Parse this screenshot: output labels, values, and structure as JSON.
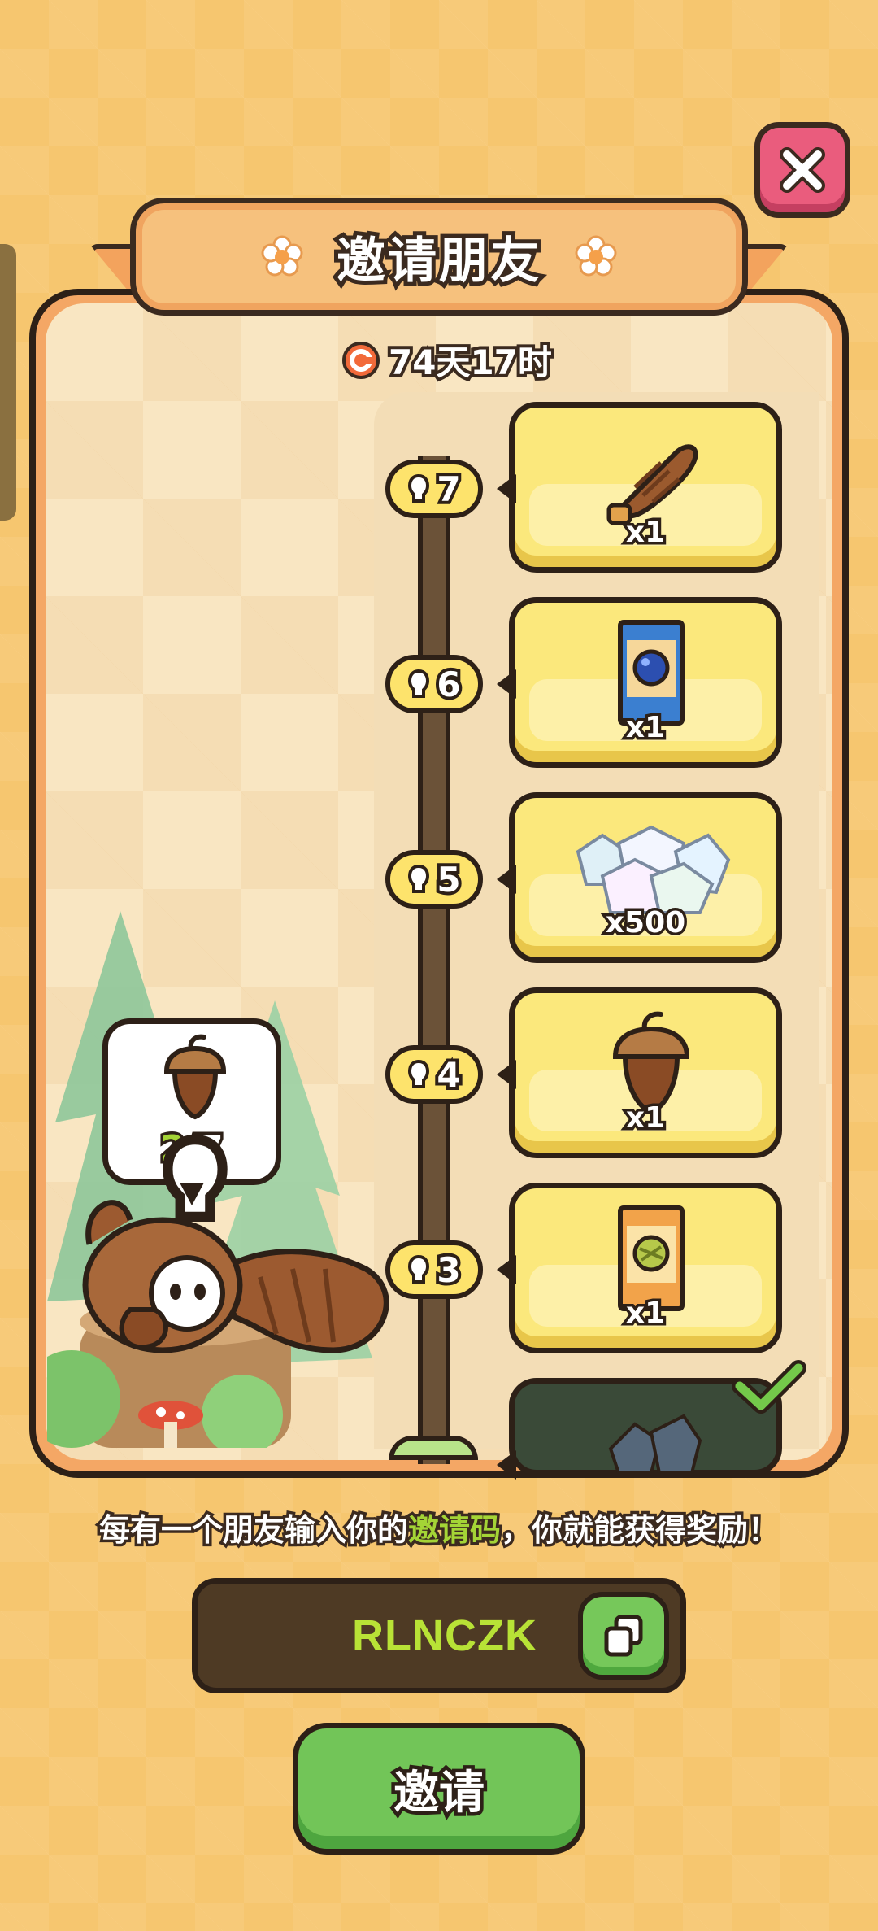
{
  "title": "邀请朋友",
  "timer": "74天17时",
  "rewards": [
    {
      "count": "7",
      "qty": "x1",
      "icon": "pinecone-tail-icon"
    },
    {
      "count": "6",
      "qty": "x1",
      "icon": "blueberry-seed-pack-icon"
    },
    {
      "count": "5",
      "qty": "x500",
      "icon": "diamond-gems-icon"
    },
    {
      "count": "4",
      "qty": "x1",
      "icon": "acorn-icon"
    },
    {
      "count": "3",
      "qty": "x1",
      "icon": "durian-seed-pack-icon"
    }
  ],
  "progress": {
    "current": "2",
    "total": "/7"
  },
  "info": {
    "before": "每有一个朋友输入你的",
    "highlight": "邀请码",
    "after": "，你就能获得奖励！"
  },
  "invite_code": "RLNCZK",
  "invite_button": "邀请",
  "colors": {
    "accent_green": "#72c558",
    "highlight_green": "#a4d436",
    "close_pink": "#ea5c7d"
  }
}
